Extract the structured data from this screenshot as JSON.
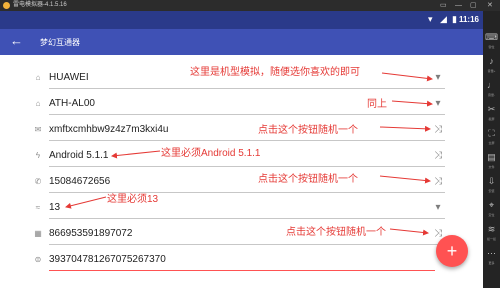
{
  "emulator": {
    "title": "雷电模拟器-4.1.5.16",
    "controls": [
      "▭",
      "—",
      "▢",
      "✕"
    ],
    "sidebar": [
      {
        "icon": "keyboard-icon",
        "label": "键位"
      },
      {
        "icon": "volume-up-icon",
        "label": "音量+"
      },
      {
        "icon": "volume-down-icon",
        "label": "音量-"
      },
      {
        "icon": "screenshot-icon",
        "label": "截屏"
      },
      {
        "icon": "fullscreen-icon",
        "label": "全屏"
      },
      {
        "icon": "folder-icon",
        "label": "文件"
      },
      {
        "icon": "install-icon",
        "label": "安装"
      },
      {
        "icon": "location-icon",
        "label": "定位"
      },
      {
        "icon": "shake-icon",
        "label": "摇一摇"
      },
      {
        "icon": "more-icon",
        "label": "更多"
      }
    ]
  },
  "status_bar": {
    "time": "11:16"
  },
  "toolbar": {
    "back_icon": "arrow-back-icon",
    "title": "梦幻互通器"
  },
  "rows": [
    {
      "icon": "bank-icon",
      "value": "HUAWEI",
      "action": "dropdown-icon"
    },
    {
      "icon": "bank-icon",
      "value": "ATH-AL00",
      "action": "dropdown-icon"
    },
    {
      "icon": "mail-icon",
      "value": "xmftxcmhbw9z4z7m3kxi4u",
      "action": "shuffle-icon"
    },
    {
      "icon": "flash-icon",
      "value": "Android 5.1.1",
      "action": "shuffle-icon"
    },
    {
      "icon": "phone-icon",
      "value": "15084672656",
      "action": "shuffle-icon"
    },
    {
      "icon": "rss-icon",
      "value": "13",
      "action": "dropdown-icon"
    },
    {
      "icon": "sim-icon",
      "value": "866953591897072",
      "action": "shuffle-icon"
    },
    {
      "icon": "subscription-icon",
      "value": "393704781267075267370",
      "action": ""
    }
  ],
  "notes": [
    "这里是机型模拟，随便选你喜欢的即可",
    "同上",
    "点击这个按钮随机一个",
    "这里必须Android 5.1.1",
    "点击这个按钮随机一个",
    "这里必须13",
    "点击这个按钮随机一个"
  ],
  "fab_label": "+",
  "colors": {
    "primary": "#3f51b5",
    "status": "#2a3a8a",
    "accent": "#ff5252",
    "annotation": "#e53935"
  }
}
